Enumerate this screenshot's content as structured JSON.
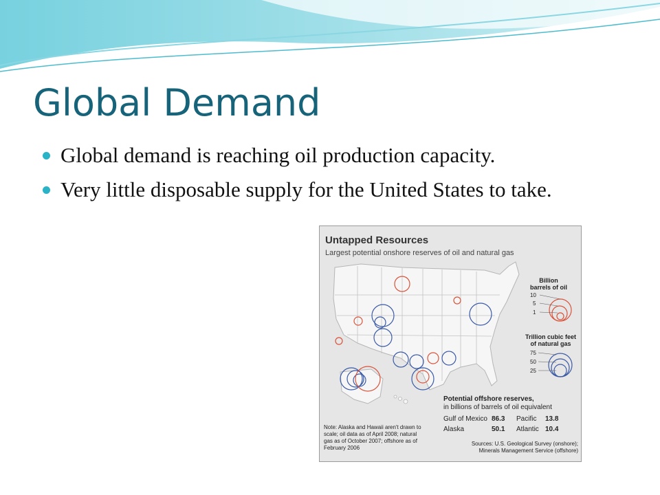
{
  "slide": {
    "title": "Global Demand",
    "bullets": [
      "Global demand is reaching oil production  capacity.",
      "Very little disposable supply for the United States to take."
    ],
    "accent_color": "#2ab3c6",
    "title_color": "#17647a"
  },
  "figure": {
    "title": "Untapped Resources",
    "subtitle": "Largest potential onshore reserves of oil and natural gas",
    "legend": {
      "oil_heading": "Billion\nbarrels of oil",
      "oil_values": [
        "10",
        "5",
        "1"
      ],
      "oil_color": "#d9533b",
      "gas_heading": "Trillion cubic feet\nof natural gas",
      "gas_values": [
        "75",
        "50",
        "25"
      ],
      "gas_color": "#3a5aa6"
    },
    "offshore": {
      "heading": "Potential offshore reserves,",
      "subheading": "in billions of barrels of oil equivalent",
      "items": [
        {
          "name": "Gulf of Mexico",
          "value": "86.3"
        },
        {
          "name": "Pacific",
          "value": "13.8"
        },
        {
          "name": "Alaska",
          "value": "50.1"
        },
        {
          "name": "Atlantic",
          "value": "10.4"
        }
      ]
    },
    "note": "Note: Alaska and Hawaii aren't drawn to scale; oil data as of April 2008; natural gas as of October 2007; offshore as of February 2006",
    "sources": "Sources: U.S. Geological Survey (onshore); Minerals Management Service (offshore)"
  }
}
